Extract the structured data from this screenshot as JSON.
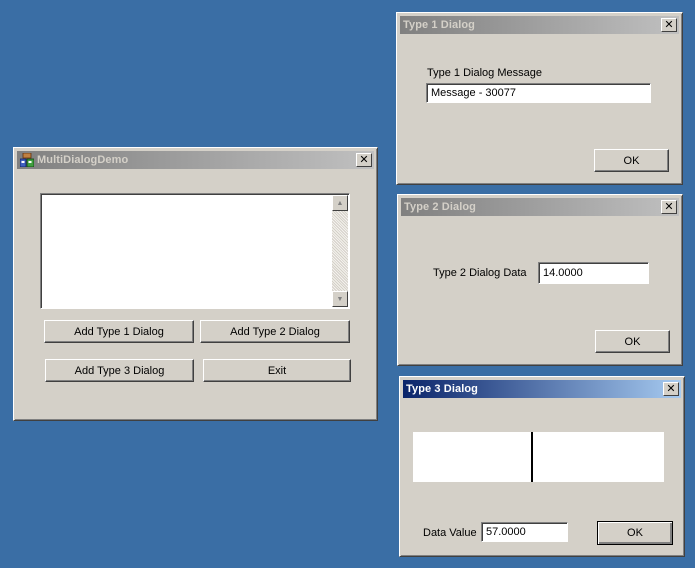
{
  "main_window": {
    "title": "MultiDialogDemo",
    "close_glyph": "✕",
    "buttons": {
      "add_type1": "Add Type 1 Dialog",
      "add_type2": "Add Type 2 Dialog",
      "add_type3": "Add Type 3 Dialog",
      "exit": "Exit"
    },
    "scroll_up_glyph": "▲",
    "scroll_down_glyph": "▼"
  },
  "dialog1": {
    "title": "Type 1 Dialog",
    "close_glyph": "✕",
    "message_label": "Type 1 Dialog Message",
    "message_value": "Message - 30077",
    "ok_label": "OK"
  },
  "dialog2": {
    "title": "Type 2 Dialog",
    "close_glyph": "✕",
    "data_label": "Type 2 Dialog Data",
    "data_value": "14.0000",
    "ok_label": "OK"
  },
  "dialog3": {
    "title": "Type 3 Dialog",
    "close_glyph": "✕",
    "data_label": "Data Value",
    "data_value": "57.0000",
    "ok_label": "OK",
    "indicator_level": 0.47
  },
  "colors": {
    "desktop": "#3a6ea5",
    "window_face": "#d4d0c8",
    "active_title_start": "#0a246a",
    "active_title_end": "#a6caf0",
    "inactive_title_start": "#808080",
    "inactive_title_end": "#c0c0c0"
  },
  "icons": [
    "app-icon",
    "close-icon",
    "scroll-up-arrow-icon",
    "scroll-down-arrow-icon"
  ]
}
